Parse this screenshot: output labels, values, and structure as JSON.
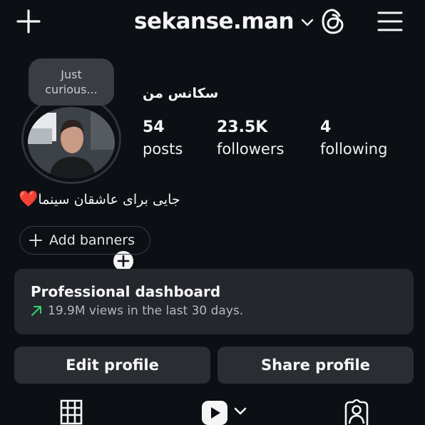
{
  "header": {
    "username": "sekanse.man",
    "icons": {
      "create": "plus-icon",
      "switch_account": "chevron-down-icon",
      "threads": "threads-icon",
      "menu": "hamburger-menu-icon"
    }
  },
  "profile": {
    "display_name": "سکانس من",
    "note": "Just curious...",
    "bio_text": "جایی برای عاشقان سینما",
    "bio_emoji": "❤️",
    "stats": [
      {
        "value": "54",
        "label": "posts"
      },
      {
        "value": "23.5K",
        "label": "followers"
      },
      {
        "value": "4",
        "label": "following"
      }
    ]
  },
  "banners": {
    "label": "Add banners"
  },
  "dashboard": {
    "title": "Professional dashboard",
    "subtitle": "19.9M views in the last 30 days.",
    "accent_color": "#2fd56d"
  },
  "actions": {
    "edit": "Edit profile",
    "share": "Share profile"
  },
  "tabs": {
    "grid": "grid-icon",
    "reels": "reels-icon",
    "tagged": "tagged-icon"
  }
}
